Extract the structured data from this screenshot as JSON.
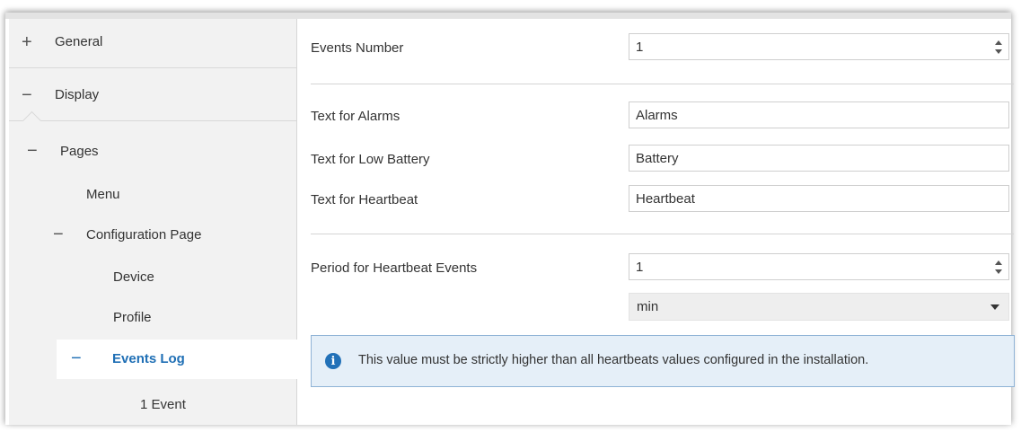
{
  "sidebar": {
    "items": [
      {
        "sign": "+",
        "label": "General"
      },
      {
        "sign": "−",
        "label": "Display"
      },
      {
        "sign": "−",
        "label": "Pages"
      },
      {
        "sign": "",
        "label": "Menu"
      },
      {
        "sign": "−",
        "label": "Configuration Page"
      },
      {
        "sign": "",
        "label": "Device"
      },
      {
        "sign": "",
        "label": "Profile"
      },
      {
        "sign": "−",
        "label": "Events Log"
      },
      {
        "sign": "",
        "label": "1 Event"
      }
    ]
  },
  "form": {
    "events_number": {
      "label": "Events Number",
      "value": "1"
    },
    "text_alarms": {
      "label": "Text for Alarms",
      "value": "Alarms"
    },
    "text_low_battery": {
      "label": "Text for Low Battery",
      "value": "Battery"
    },
    "text_heartbeat": {
      "label": "Text for Heartbeat",
      "value": "Heartbeat"
    },
    "heartbeat_period": {
      "label": "Period for Heartbeat Events",
      "value": "1",
      "unit": "min"
    }
  },
  "info": {
    "icon": "info-icon",
    "text": "This value must be strictly higher than all heartbeats values configured in the installation."
  },
  "colors": {
    "accent": "#1f6fb5",
    "info_bg": "#e5eff8",
    "info_border": "#8fb3d6",
    "sidebar_bg": "#f2f2f2"
  }
}
